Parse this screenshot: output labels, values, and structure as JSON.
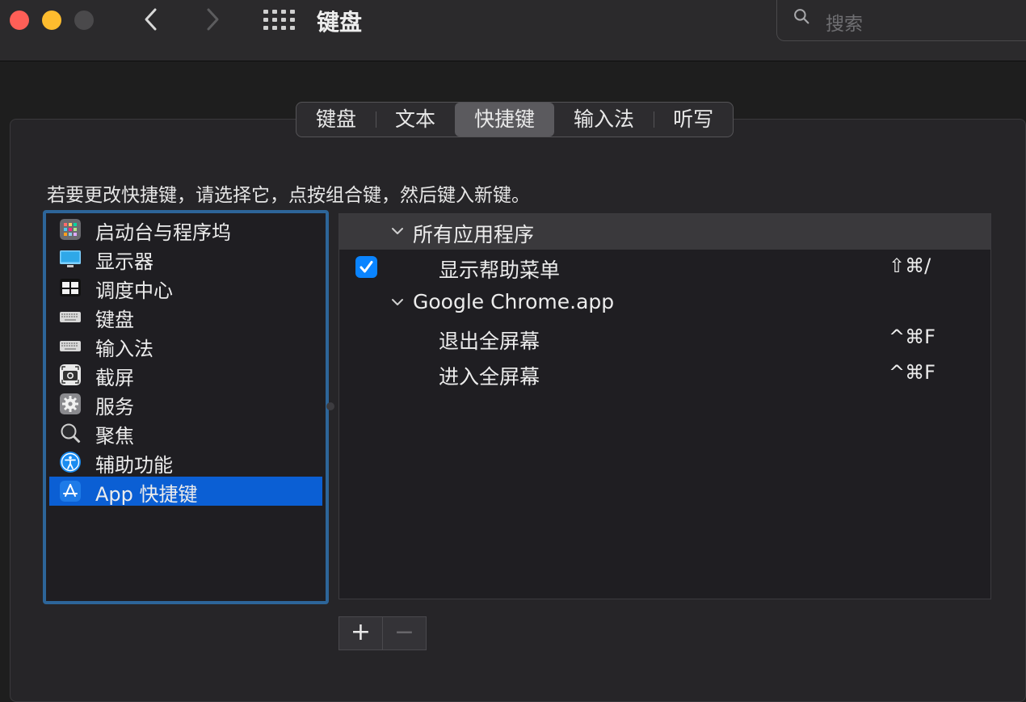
{
  "window": {
    "title": "键盘",
    "search_placeholder": "搜索"
  },
  "tabs": [
    {
      "label": "键盘"
    },
    {
      "label": "文本"
    },
    {
      "label": "快捷键"
    },
    {
      "label": "输入法"
    },
    {
      "label": "听写"
    }
  ],
  "active_tab": "快捷键",
  "instructions": "若要更改快捷键，请选择它，点按组合键，然后键入新键。",
  "categories": [
    {
      "label": "启动台与程序坞",
      "icon": "launchpad-icon"
    },
    {
      "label": "显示器",
      "icon": "display-icon"
    },
    {
      "label": "调度中心",
      "icon": "mission-control-icon"
    },
    {
      "label": "键盘",
      "icon": "keyboard-icon"
    },
    {
      "label": "输入法",
      "icon": "keyboard-icon"
    },
    {
      "label": "截屏",
      "icon": "screenshot-icon"
    },
    {
      "label": "服务",
      "icon": "gear-icon"
    },
    {
      "label": "聚焦",
      "icon": "magnifier-icon"
    },
    {
      "label": "辅助功能",
      "icon": "accessibility-icon"
    },
    {
      "label": "App 快捷键",
      "icon": "app-store-icon",
      "selected": true
    }
  ],
  "shortcuts": {
    "group1": {
      "label": "所有应用程序",
      "items": [
        {
          "label": "显示帮助菜单",
          "shortcut": "⇧⌘/",
          "checked": true
        }
      ]
    },
    "group2": {
      "label": "Google Chrome.app",
      "items": [
        {
          "label": "退出全屏幕",
          "shortcut": "^⌘F"
        },
        {
          "label": "进入全屏幕",
          "shortcut": "^⌘F"
        }
      ]
    }
  },
  "buttons": {
    "add": "+",
    "remove": "−"
  },
  "colors": {
    "selection": "#0b5fd4",
    "checkbox": "#0a84ff",
    "focus_ring": "#2d6599"
  }
}
